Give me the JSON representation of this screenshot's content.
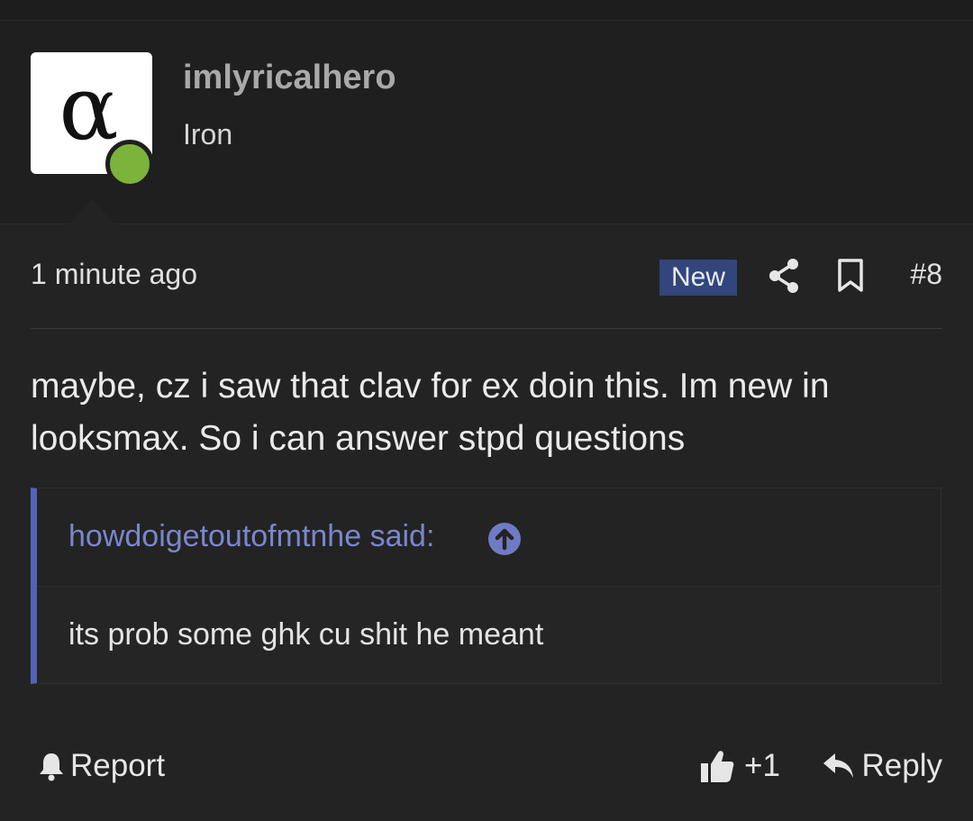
{
  "author": {
    "avatar_letter": "α",
    "username": "imlyricalhero",
    "user_title": "Iron",
    "online_status_color": "#7cb33b"
  },
  "meta": {
    "timestamp": "1 minute ago",
    "badge": "New",
    "post_number": "#8",
    "icons": [
      "share-icon",
      "bookmark-icon"
    ]
  },
  "message": {
    "body": "maybe, cz i saw that clav for ex doin this. Im new in looksmax. So i can answer stpd questions"
  },
  "quote": {
    "author_line": "howdoigetoutofmtnhe said:",
    "text": "its prob some ghk cu shit he meant",
    "accent_color": "#5463b8"
  },
  "footer": {
    "report_label": "Report",
    "like_label": "+1",
    "reply_label": "Reply"
  }
}
